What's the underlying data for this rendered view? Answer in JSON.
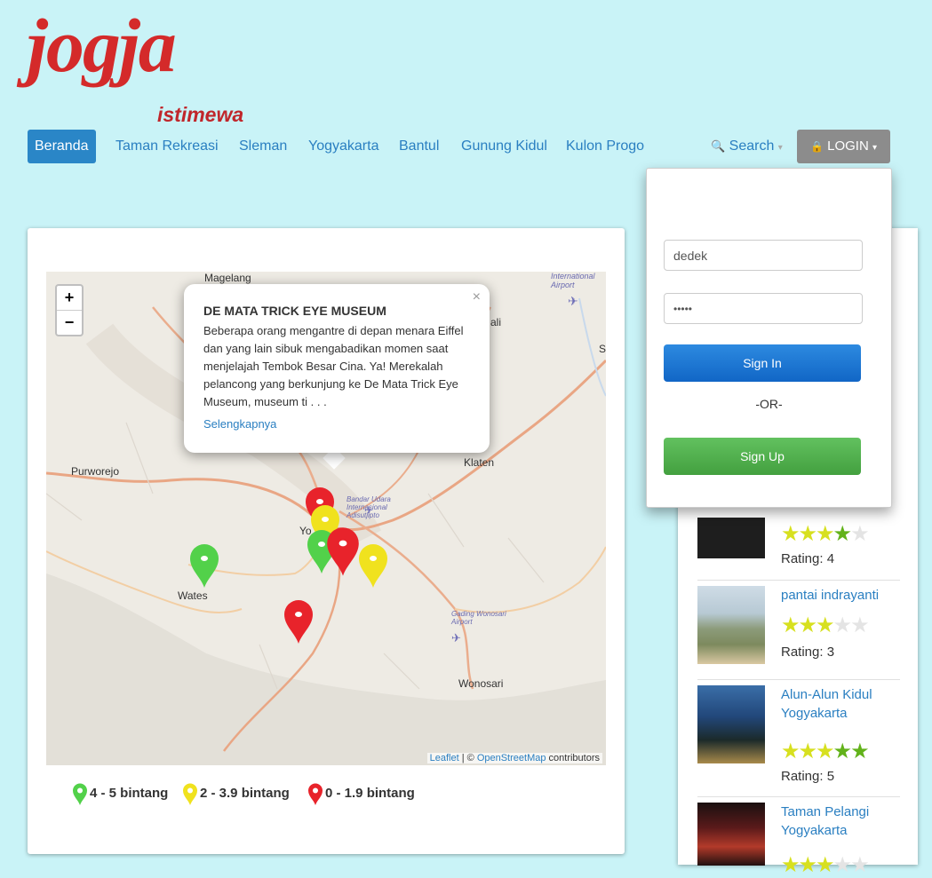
{
  "brand": {
    "logo_main": "jogja",
    "logo_sub": "istimewa"
  },
  "nav": {
    "items": [
      {
        "label": "Beranda",
        "active": true
      },
      {
        "label": "Taman Rekreasi"
      },
      {
        "label": "Sleman"
      },
      {
        "label": "Yogyakarta"
      },
      {
        "label": "Bantul"
      },
      {
        "label": "Gunung Kidul"
      },
      {
        "label": "Kulon Progo"
      }
    ],
    "search_label": "Search",
    "login_label": "LOGIN"
  },
  "map": {
    "zoom_in": "+",
    "zoom_out": "−",
    "place_labels": [
      "Magelang",
      "International Airport",
      "Purworejo",
      "Klaten",
      "Bandar Udara Internasional Adisutjipto",
      "Yo",
      "Wates",
      "Gading Wonosari Airport",
      "Wonosari",
      "ali",
      "S"
    ],
    "popup": {
      "close": "×",
      "title": "DE MATA TRICK EYE MUSEUM",
      "description": "Beberapa orang mengantre di depan menara Eiffel dan yang lain sibuk mengabadikan momen saat menjelajah Tembok Besar Cina. Ya! Merekalah pelancong yang berkunjung ke De Mata Trick Eye Museum, museum ti . . .",
      "more_link": "Selengkapnya"
    },
    "attribution": {
      "leaflet": "Leaflet",
      "sep": " | © ",
      "osm": "OpenStreetMap",
      "suffix": " contributors"
    },
    "marker_colors": {
      "green": "#52d14a",
      "yellow": "#f0e21e",
      "red": "#e8232b"
    }
  },
  "legend": [
    {
      "label": "4 - 5 bintang",
      "color": "#52d14a"
    },
    {
      "label": "2 - 3.9 bintang",
      "color": "#f0e21e"
    },
    {
      "label": "0 - 1.9 bintang",
      "color": "#e8232b"
    }
  ],
  "login_form": {
    "username_value": "dedek",
    "password_value": "•••••",
    "signin_label": "Sign In",
    "or_label": "-OR-",
    "signup_label": "Sign Up"
  },
  "side_list": [
    {
      "name": "",
      "stars": 4,
      "rating_text": "Rating: 4"
    },
    {
      "name": "pantai indrayanti",
      "stars": 3,
      "rating_text": "Rating: 3"
    },
    {
      "name": "Alun-Alun Kidul Yogyakarta",
      "stars": 5,
      "rating_text": "Rating: 5"
    },
    {
      "name": "Taman Pelangi Yogyakarta",
      "stars": 3,
      "rating_text": ""
    }
  ]
}
